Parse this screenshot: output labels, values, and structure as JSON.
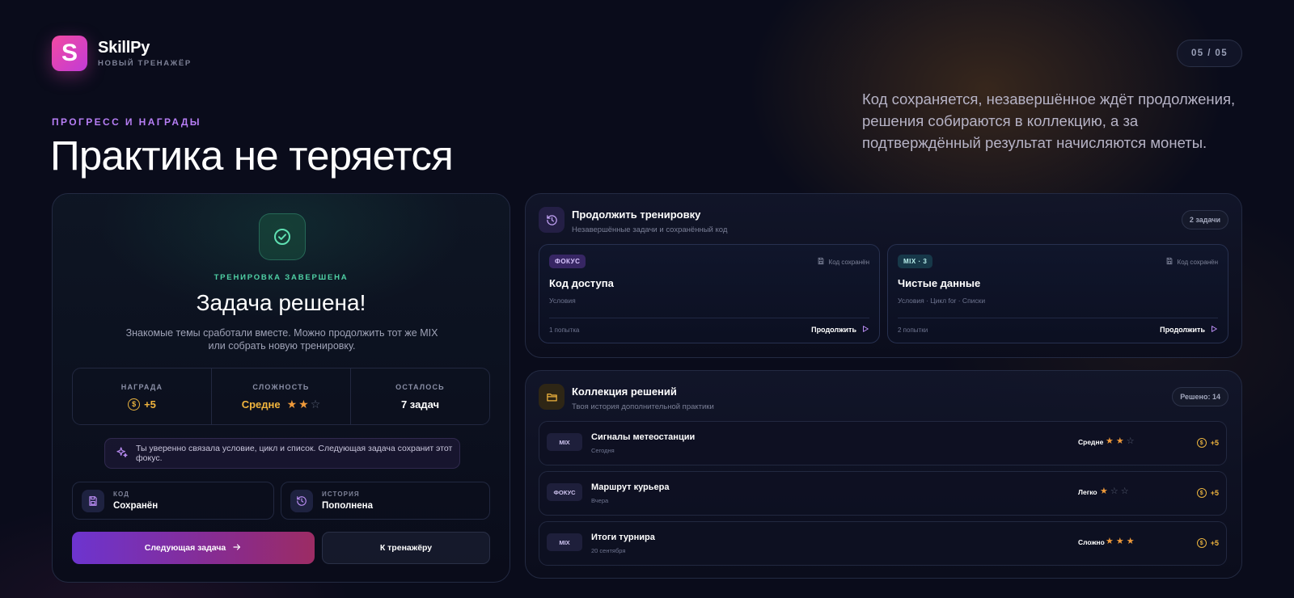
{
  "brand": {
    "logo_letter": "S",
    "name": "SkillPy",
    "subtitle": "НОВЫЙ ТРЕНАЖЁР"
  },
  "pager": "05 / 05",
  "hero": {
    "eyebrow": "ПРОГРЕСС И НАГРАДЫ",
    "title": "Практика не теряется",
    "lead": "Код сохраняется, незавершённое ждёт продолжения, решения собираются в коллекцию, а за подтверждённый результат начисляются монеты."
  },
  "result": {
    "icon": "check-circle-icon",
    "status_label": "ТРЕНИРОВКА ЗАВЕРШЕНА",
    "title": "Задача решена!",
    "text": "Знакомые темы сработали вместе. Можно продолжить тот же MIX или собрать новую тренировку.",
    "stats": {
      "reward_label": "НАГРАДА",
      "reward_value": "+5",
      "difficulty_label": "СЛОЖНОСТЬ",
      "difficulty_value": "Средне",
      "difficulty_stars": 2,
      "remaining_label": "ОСТАЛОСЬ",
      "remaining_value": "7 задач"
    },
    "tip": "Ты уверенно связала условие, цикл и список. Следующая задача сохранит этот фокус.",
    "code_label": "КОД",
    "code_value": "Сохранён",
    "history_label": "ИСТОРИЯ",
    "history_value": "Пополнена",
    "next_button": "Следующая задача",
    "back_button": "К тренажёру"
  },
  "continue_panel": {
    "title": "Продолжить тренировку",
    "subtitle": "Незавершённые задачи и сохранённый код",
    "count": "2 задачи",
    "tasks": [
      {
        "tag": "ФОКУС",
        "saved": "Код сохранён",
        "title": "Код доступа",
        "topics": "Условия",
        "attempts": "1 попытка",
        "action": "Продолжить"
      },
      {
        "tag": "MIX · 3",
        "saved": "Код сохранён",
        "title": "Чистые данные",
        "topics": "Условия · Цикл for · Списки",
        "attempts": "2 попытки",
        "action": "Продолжить"
      }
    ]
  },
  "collection_panel": {
    "title": "Коллекция решений",
    "subtitle": "Твоя история дополнительной практики",
    "count": "Решено: 14",
    "items": [
      {
        "tag": "MIX",
        "name": "Сигналы метеостанции",
        "date": "Сегодня",
        "difficulty": "Средне",
        "stars": 2,
        "reward": "+5"
      },
      {
        "tag": "ФОКУС",
        "name": "Маршрут курьера",
        "date": "Вчера",
        "difficulty": "Легко",
        "stars": 1,
        "reward": "+5"
      },
      {
        "tag": "MIX",
        "name": "Итоги турнира",
        "date": "20 сентября",
        "difficulty": "Сложно",
        "stars": 3,
        "reward": "+5"
      }
    ]
  },
  "colors": {
    "accent_purple": "#b77ef5",
    "success_green": "#4fd1a5",
    "gold": "#f0b43d",
    "star": "#ef9a3a",
    "background": "#0a0c1b"
  }
}
